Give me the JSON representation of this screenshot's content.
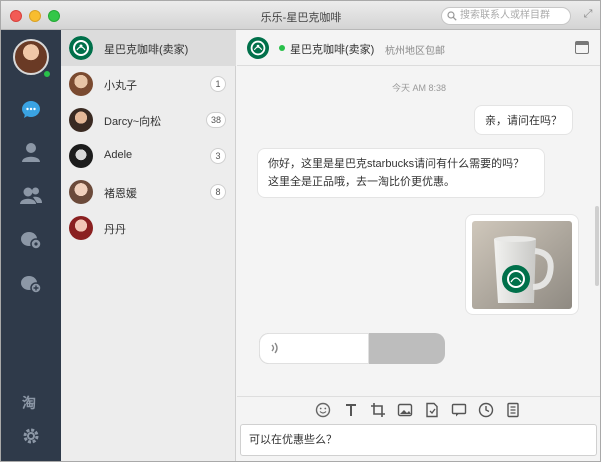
{
  "window": {
    "title": "乐乐-星巴克咖啡"
  },
  "search": {
    "placeholder": "搜索联系人或样目群"
  },
  "contacts": [
    {
      "name": "星巴克咖啡(卖家)",
      "badge": "",
      "avatar": "starbucks"
    },
    {
      "name": "小丸子",
      "badge": "1",
      "avatar": "girl-brown"
    },
    {
      "name": "Darcy~向松",
      "badge": "38",
      "avatar": "girl-dark"
    },
    {
      "name": "Adele",
      "badge": "3",
      "avatar": "bw"
    },
    {
      "name": "褚恩媛",
      "badge": "8",
      "avatar": "girl-light"
    },
    {
      "name": "丹丹",
      "badge": "",
      "avatar": "girl-red"
    }
  ],
  "chat": {
    "name": "星巴克咖啡(卖家)",
    "subtitle": "杭州地区包邮",
    "timestamp": "今天 AM 8:38",
    "messages": [
      {
        "side": "right",
        "type": "text",
        "text": "亲，请问在吗？"
      },
      {
        "side": "left",
        "type": "text",
        "text": "你好，这里是星巴克starbucks请问有什么需要的吗？这里全是正品哦，去一淘比价更优惠。"
      },
      {
        "side": "right",
        "type": "image",
        "description": "starbucks mug photo"
      },
      {
        "side": "left",
        "type": "voice",
        "progress": 0.59
      }
    ]
  },
  "input": {
    "value": "可以在优惠些么？"
  },
  "colors": {
    "nav_bg": "#2f3a4a",
    "online": "#28c04a",
    "active_nav": "#3aa3e3"
  }
}
